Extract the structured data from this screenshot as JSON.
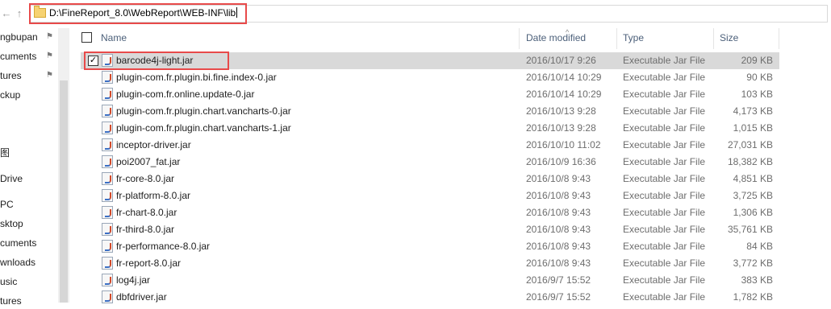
{
  "address": {
    "path": "D:\\FineReport_8.0\\WebReport\\WEB-INF\\lib"
  },
  "nav": {
    "back": "←",
    "up": "↑",
    "items": [
      {
        "label": "ngbupan",
        "pinned": true
      },
      {
        "label": "cuments",
        "pinned": true
      },
      {
        "label": "tures",
        "pinned": true
      },
      {
        "label": "ckup",
        "pinned": false
      },
      {
        "label": "图",
        "pinned": false
      },
      {
        "label": "Drive",
        "pinned": false
      },
      {
        "label": "PC",
        "pinned": false
      },
      {
        "label": "sktop",
        "pinned": false
      },
      {
        "label": "cuments",
        "pinned": false
      },
      {
        "label": "wnloads",
        "pinned": false
      },
      {
        "label": "usic",
        "pinned": false
      },
      {
        "label": "tures",
        "pinned": false
      }
    ]
  },
  "columns": {
    "name": "Name",
    "date": "Date modified",
    "type": "Type",
    "size": "Size"
  },
  "files": [
    {
      "name": "barcode4j-light.jar",
      "date": "2016/10/17 9:26",
      "type": "Executable Jar File",
      "size": "209 KB",
      "selected": true
    },
    {
      "name": "plugin-com.fr.plugin.bi.fine.index-0.jar",
      "date": "2016/10/14 10:29",
      "type": "Executable Jar File",
      "size": "90 KB"
    },
    {
      "name": "plugin-com.fr.online.update-0.jar",
      "date": "2016/10/14 10:29",
      "type": "Executable Jar File",
      "size": "103 KB"
    },
    {
      "name": "plugin-com.fr.plugin.chart.vancharts-0.jar",
      "date": "2016/10/13 9:28",
      "type": "Executable Jar File",
      "size": "4,173 KB"
    },
    {
      "name": "plugin-com.fr.plugin.chart.vancharts-1.jar",
      "date": "2016/10/13 9:28",
      "type": "Executable Jar File",
      "size": "1,015 KB"
    },
    {
      "name": "inceptor-driver.jar",
      "date": "2016/10/10 11:02",
      "type": "Executable Jar File",
      "size": "27,031 KB"
    },
    {
      "name": "poi2007_fat.jar",
      "date": "2016/10/9 16:36",
      "type": "Executable Jar File",
      "size": "18,382 KB"
    },
    {
      "name": "fr-core-8.0.jar",
      "date": "2016/10/8 9:43",
      "type": "Executable Jar File",
      "size": "4,851 KB"
    },
    {
      "name": "fr-platform-8.0.jar",
      "date": "2016/10/8 9:43",
      "type": "Executable Jar File",
      "size": "3,725 KB"
    },
    {
      "name": "fr-chart-8.0.jar",
      "date": "2016/10/8 9:43",
      "type": "Executable Jar File",
      "size": "1,306 KB"
    },
    {
      "name": "fr-third-8.0.jar",
      "date": "2016/10/8 9:43",
      "type": "Executable Jar File",
      "size": "35,761 KB"
    },
    {
      "name": "fr-performance-8.0.jar",
      "date": "2016/10/8 9:43",
      "type": "Executable Jar File",
      "size": "84 KB"
    },
    {
      "name": "fr-report-8.0.jar",
      "date": "2016/10/8 9:43",
      "type": "Executable Jar File",
      "size": "3,772 KB"
    },
    {
      "name": "log4j.jar",
      "date": "2016/9/7 15:52",
      "type": "Executable Jar File",
      "size": "383 KB"
    },
    {
      "name": "dbfdriver.jar",
      "date": "2016/9/7 15:52",
      "type": "Executable Jar File",
      "size": "1,782 KB"
    }
  ]
}
